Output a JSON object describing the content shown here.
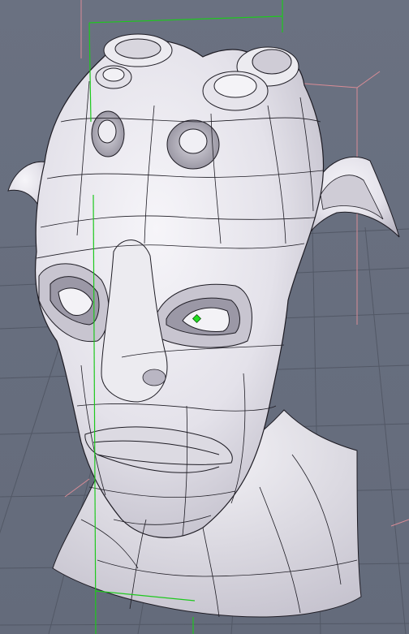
{
  "viewport": {
    "background_color": "#6b7282",
    "grid_color": "#545a68",
    "bounding_box_color": "#d98c96",
    "axis_color": "#1ec81e",
    "mesh_surface_color": "#e9e7ee",
    "mesh_wire_color": "#1e1c24",
    "selected_vertex_color": "#22dd22"
  },
  "scene": {
    "object": "alien-head-subdivision-mesh",
    "selection": "single-vertex-near-right-eye"
  }
}
